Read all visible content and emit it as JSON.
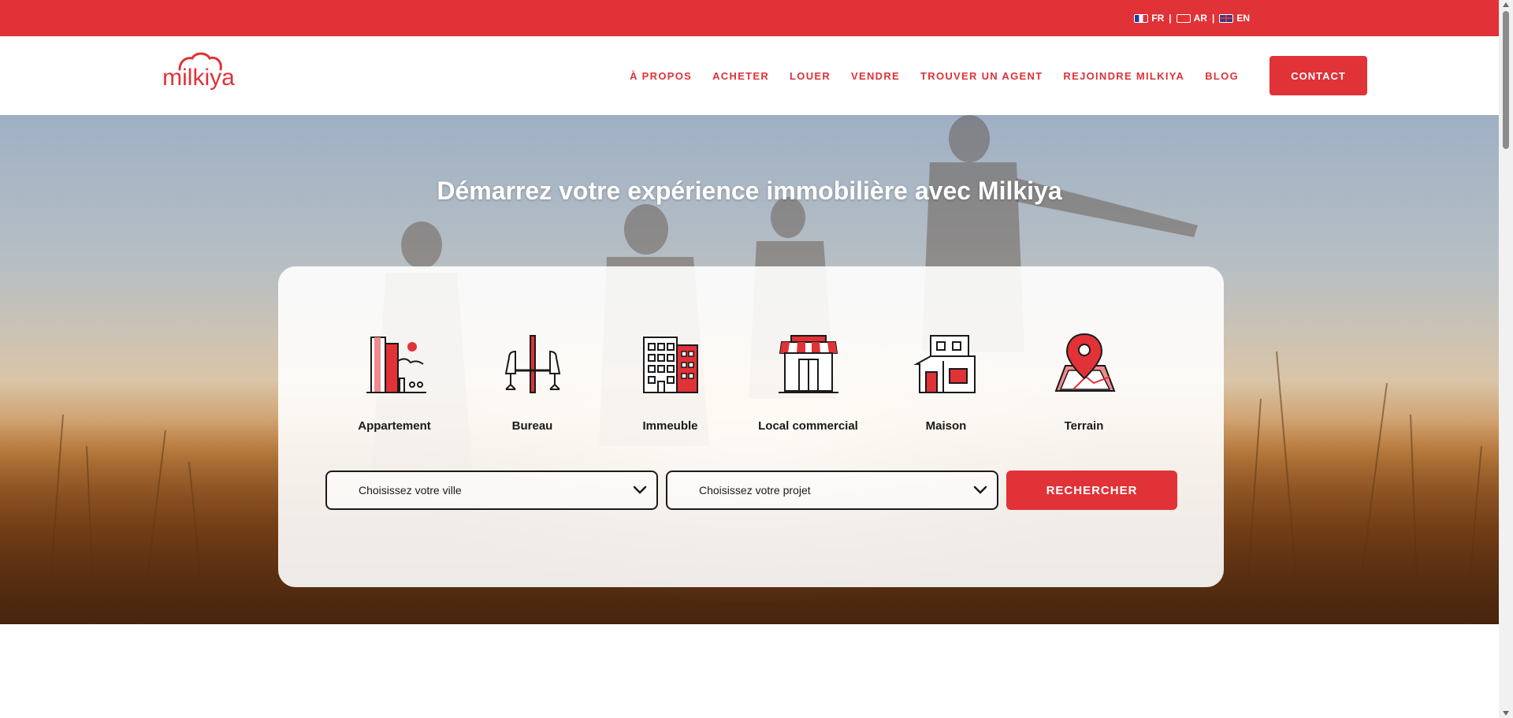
{
  "colors": {
    "brand": "#e03237",
    "text": "#1a1a1a"
  },
  "languages": [
    {
      "code": "FR",
      "icon": "flag-fr-icon"
    },
    {
      "code": "AR",
      "icon": "flag-ar-icon"
    },
    {
      "code": "EN",
      "icon": "flag-en-icon"
    }
  ],
  "lang_separator": "|",
  "logo": {
    "text": "milkiya",
    "icon": "cloud-logo-icon"
  },
  "nav": {
    "items": [
      {
        "label": "À PROPOS"
      },
      {
        "label": "ACHETER"
      },
      {
        "label": "LOUER"
      },
      {
        "label": "VENDRE"
      },
      {
        "label": "TROUVER UN AGENT"
      },
      {
        "label": "REJOINDRE MILKIYA"
      },
      {
        "label": "BLOG"
      }
    ],
    "contact_label": "CONTACT"
  },
  "hero": {
    "title": "Démarrez votre expérience immobilière avec Milkiya"
  },
  "search": {
    "property_types": [
      {
        "label": "Appartement",
        "icon": "apartment-icon"
      },
      {
        "label": "Bureau",
        "icon": "office-icon"
      },
      {
        "label": "Immeuble",
        "icon": "building-icon"
      },
      {
        "label": "Local commercial",
        "icon": "storefront-icon"
      },
      {
        "label": "Maison",
        "icon": "house-icon"
      },
      {
        "label": "Terrain",
        "icon": "land-pin-icon"
      }
    ],
    "city_select": {
      "value": "Choisissez votre ville",
      "icon": "chevron-down-icon"
    },
    "project_select": {
      "value": "Choisissez votre projet",
      "icon": "chevron-down-icon"
    },
    "button_label": "RECHERCHER"
  }
}
